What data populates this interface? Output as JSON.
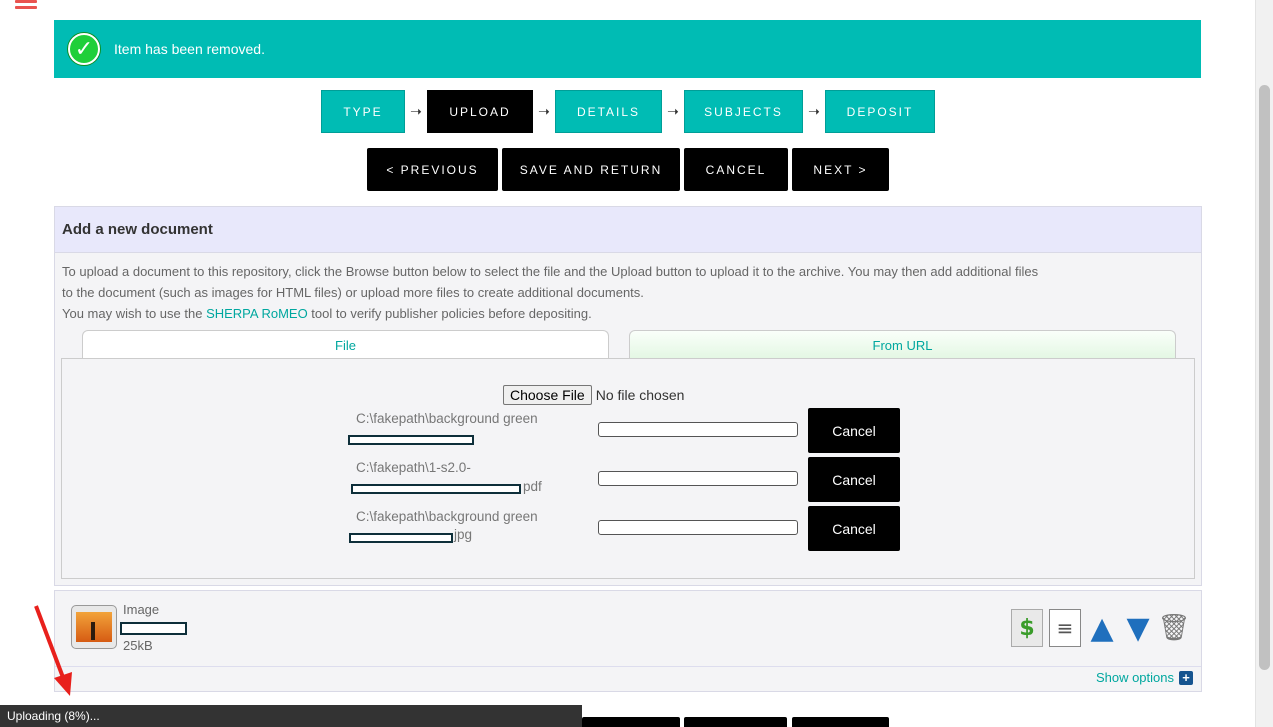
{
  "alert": {
    "message": "Item has been removed."
  },
  "steps": [
    {
      "label": "TYPE",
      "active": false
    },
    {
      "label": "UPLOAD",
      "active": true
    },
    {
      "label": "DETAILS",
      "active": false
    },
    {
      "label": "SUBJECTS",
      "active": false
    },
    {
      "label": "DEPOSIT",
      "active": false
    }
  ],
  "nav": {
    "previous": "< PREVIOUS",
    "save_return": "SAVE AND RETURN",
    "cancel": "CANCEL",
    "next": "NEXT >"
  },
  "add_document": {
    "title": "Add a new document",
    "intro_line1": "To upload a document to this repository, click the Browse button below to select the file and the Upload button to upload it to the archive. You may then add additional files",
    "intro_line2": "to the document (such as images for HTML files) or upload more files to create additional documents.",
    "intro_line3_pre": "You may wish to use the ",
    "intro_link": "SHERPA RoMEO",
    "intro_line3_post": " tool to verify publisher policies before depositing.",
    "tabs": {
      "file": "File",
      "url": "From URL"
    },
    "choose_file_button": "Choose File",
    "no_file_text": "No file chosen",
    "uploads": [
      {
        "filename": "C:\\fakepath\\background green",
        "ext": "",
        "cancel_label": "Cancel"
      },
      {
        "filename": "C:\\fakepath\\1-s2.0-",
        "ext": "pdf",
        "cancel_label": "Cancel"
      },
      {
        "filename": "C:\\fakepath\\background green",
        "ext": "jpg",
        "cancel_label": "Cancel"
      }
    ]
  },
  "document": {
    "type": "Image",
    "size": "25kB",
    "show_options": "Show options",
    "actions": [
      "convert-icon",
      "details-icon",
      "move-up-icon",
      "move-down-icon",
      "delete-icon"
    ]
  },
  "status_bar": {
    "text": "Uploading (8%)..."
  },
  "colors": {
    "accent": "#00bcb4",
    "active_step": "#000000",
    "link": "#00a79f",
    "annotation_arrow": "#e8201c"
  }
}
